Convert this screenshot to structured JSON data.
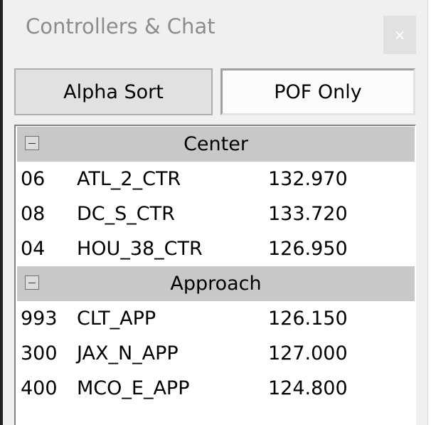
{
  "window": {
    "title": "Controllers & Chat",
    "close_label": "×"
  },
  "buttons": {
    "alpha_sort": "Alpha Sort",
    "pof_only": "POF Only",
    "pof_only_pressed": true
  },
  "groups": [
    {
      "label": "Center",
      "collapse_symbol": "minus",
      "rows": [
        {
          "id": "06",
          "name": "ATL_2_CTR",
          "freq": "132.970"
        },
        {
          "id": "08",
          "name": "DC_S_CTR",
          "freq": "133.720"
        },
        {
          "id": "04",
          "name": "HOU_38_CTR",
          "freq": "126.950"
        }
      ]
    },
    {
      "label": "Approach",
      "collapse_symbol": "minus",
      "rows": [
        {
          "id": "993",
          "name": "CLT_APP",
          "freq": "126.150"
        },
        {
          "id": "300",
          "name": "JAX_N_APP",
          "freq": "127.000"
        },
        {
          "id": "400",
          "name": "MCO_E_APP",
          "freq": "124.800"
        }
      ]
    }
  ],
  "colors": {
    "header_bg": "#c8c8c8",
    "button_bg": "#e1e1e1",
    "title_text": "#8c8c8c"
  }
}
